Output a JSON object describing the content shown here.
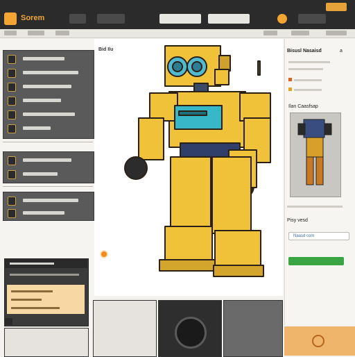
{
  "header": {
    "brand": "Sorem"
  },
  "main": {
    "caption": "Bid Ilu"
  },
  "sidebar": {
    "pill_label": ""
  },
  "right": {
    "title": "Bisusl Nasaisd",
    "title_suffix": "a",
    "section_title": "Ilan Caasfsap",
    "form_label": "Pisy vesd",
    "input_value": "Naasd com"
  },
  "colors": {
    "accent": "#f2a533",
    "brand": "#f2a533",
    "button_green": "#3aa543",
    "pill_blue": "#39a4e6",
    "robot_yellow": "#f0c23a"
  },
  "icons": [
    "app-logo-icon",
    "robot-illustration",
    "robot-thumbnail-icon",
    "camera-lens-icon"
  ]
}
